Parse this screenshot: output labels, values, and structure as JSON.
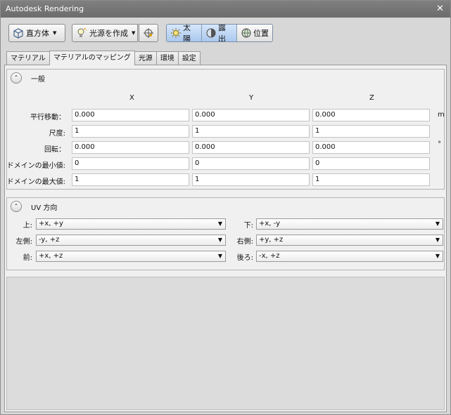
{
  "window": {
    "title": "Autodesk Rendering",
    "close_glyph": "✕"
  },
  "toolbar": {
    "shape_button": {
      "label": "直方体",
      "icon": "box-icon"
    },
    "create_light_button": {
      "label": "光源を作成",
      "icon": "light-bulb-icon"
    },
    "target_button": {
      "icon": "crosshair-icon"
    },
    "sun": {
      "label": "太陽",
      "icon": "sun-icon"
    },
    "exposure": {
      "label": "露出",
      "icon": "exposure-icon"
    },
    "location": {
      "label": "位置",
      "icon": "globe-icon"
    },
    "accent_color": "#aac8ee"
  },
  "tabs": [
    {
      "label": "マテリアル",
      "active": false
    },
    {
      "label": "マテリアルのマッピング",
      "active": true
    },
    {
      "label": "光源",
      "active": false
    },
    {
      "label": "環境",
      "active": false
    },
    {
      "label": "設定",
      "active": false
    }
  ],
  "general": {
    "title": "一般",
    "collapse_glyph": "⌃",
    "columns": [
      "X",
      "Y",
      "Z"
    ],
    "rows": [
      {
        "label": "平行移動：",
        "values": [
          "0.000",
          "0.000",
          "0.000"
        ],
        "unit": "m"
      },
      {
        "label": "尺度:",
        "values": [
          "1",
          "1",
          "1"
        ],
        "unit": ""
      },
      {
        "label": "回転：",
        "values": [
          "0.000",
          "0.000",
          "0.000"
        ],
        "unit": "°"
      },
      {
        "label": "ドメインの最小値:",
        "values": [
          "0",
          "0",
          "0"
        ],
        "unit": ""
      },
      {
        "label": "ドメインの最大値:",
        "values": [
          "1",
          "1",
          "1"
        ],
        "unit": ""
      }
    ]
  },
  "uv": {
    "title": "UV 方向",
    "collapse_glyph": "⌃",
    "dropdown_arrow": "▼",
    "fields": [
      {
        "label": "上:",
        "value": "+x, +y"
      },
      {
        "label": "下:",
        "value": "+x, -y"
      },
      {
        "label": "左側:",
        "value": "-y, +z"
      },
      {
        "label": "右側:",
        "value": "+y, +z"
      },
      {
        "label": "前:",
        "value": "+x, +z"
      },
      {
        "label": "後ろ:",
        "value": "-x, +z"
      }
    ]
  }
}
